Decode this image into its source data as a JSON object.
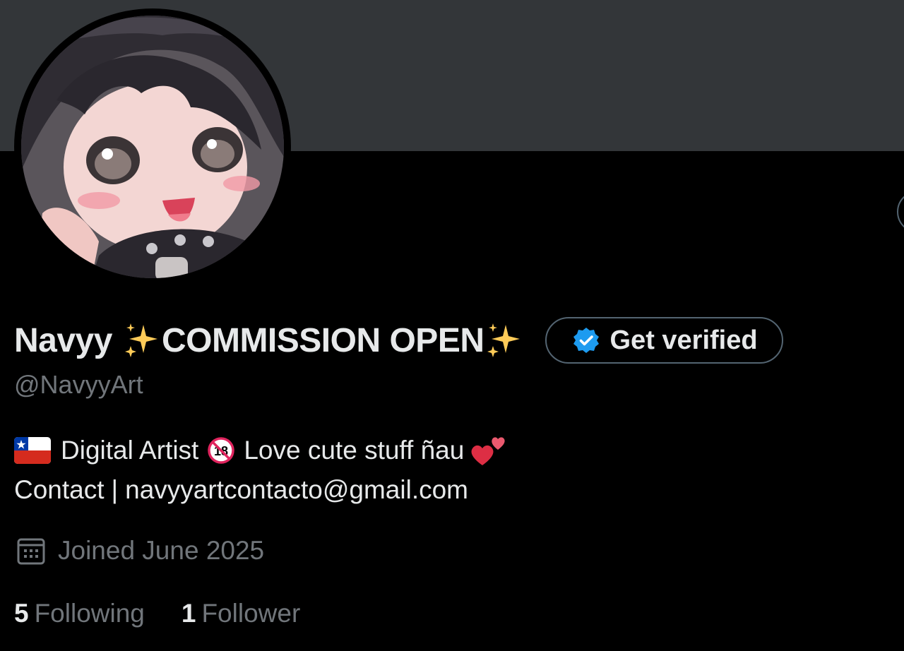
{
  "profile": {
    "display_name_part1": "Navyy",
    "display_name_part2": "COMMISSION OPEN",
    "handle": "@NavyyArt",
    "get_verified_label": "Get verified",
    "bio": {
      "line1_part1": "Digital Artist",
      "line1_part2": "Love cute stuff ñau",
      "line2_contact": "Contact",
      "line2_separator": "|",
      "line2_email": "navyyartcontacto@gmail.com"
    },
    "joined": "Joined June 2025",
    "stats": {
      "following_count": "5",
      "following_label": "Following",
      "followers_count": "1",
      "followers_label": "Follower"
    }
  },
  "icons": {
    "sparkles": "sparkles-icon",
    "verified_badge": "verified-badge-icon",
    "flag": "chile-flag-icon",
    "age_restriction": "no-under-18-icon",
    "hearts": "two-hearts-icon",
    "calendar": "calendar-icon"
  },
  "colors": {
    "background": "#000000",
    "banner": "#333639",
    "primary_text": "#e7e9ea",
    "secondary_text": "#71767b",
    "border": "#536471",
    "verified_blue": "#1d9bf0"
  }
}
